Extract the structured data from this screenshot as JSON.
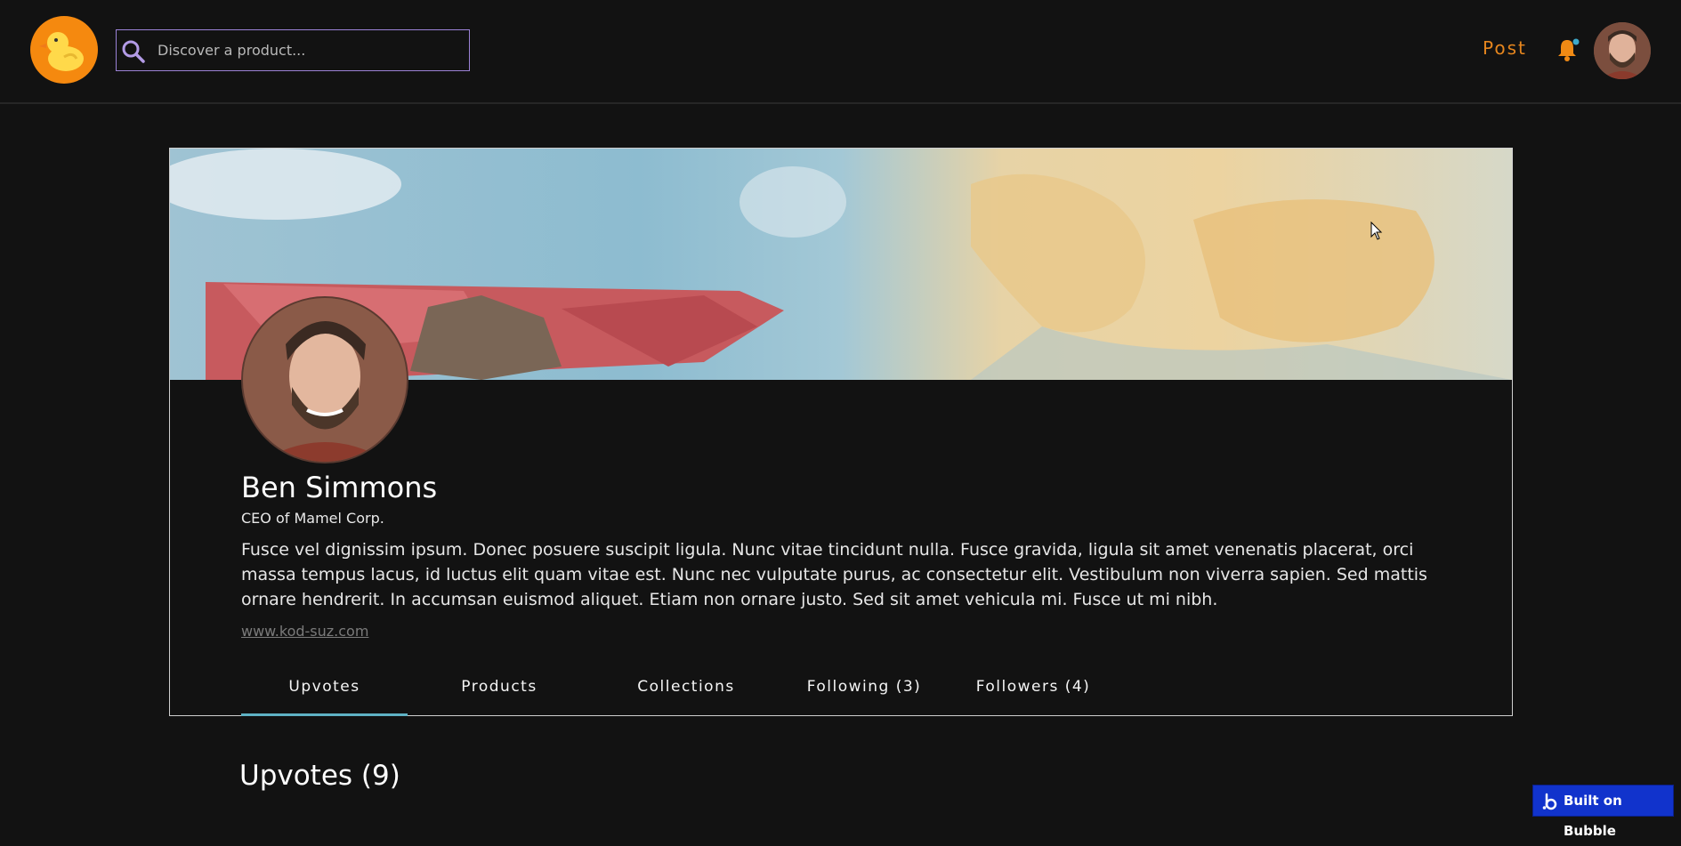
{
  "header": {
    "search_placeholder": "Discover a product...",
    "post_label": "Post",
    "notification_dot_color": "#3fa9c9"
  },
  "profile": {
    "name": "Ben Simmons",
    "role": "CEO of Mamel Corp.",
    "bio": "Fusce vel dignissim ipsum. Donec posuere suscipit ligula. Nunc vitae tincidunt nulla. Fusce gravida, ligula sit amet venenatis placerat, orci massa tempus lacus, id luctus elit quam vitae est. Nunc nec vulputate purus, ac consectetur elit. Vestibulum non viverra sapien. Sed mattis ornare hendrerit. In accumsan euismod aliquet. Etiam non ornare justo. Sed sit amet vehicula mi. Fusce ut mi nibh.",
    "website": "www.kod-suz.com"
  },
  "tabs": [
    {
      "label": "Upvotes",
      "active": true
    },
    {
      "label": "Products",
      "active": false
    },
    {
      "label": "Collections",
      "active": false
    },
    {
      "label": "Following (3)",
      "active": false
    },
    {
      "label": "Followers (4)",
      "active": false
    }
  ],
  "section": {
    "title": "Upvotes (9)"
  },
  "badge": {
    "label": "Built on Bubble"
  },
  "colors": {
    "background": "#121212",
    "accent_orange": "#e6861e",
    "search_border": "#9b82d6",
    "active_tab_underline": "#5fb2c4",
    "bubble_blue": "#1133cc"
  }
}
